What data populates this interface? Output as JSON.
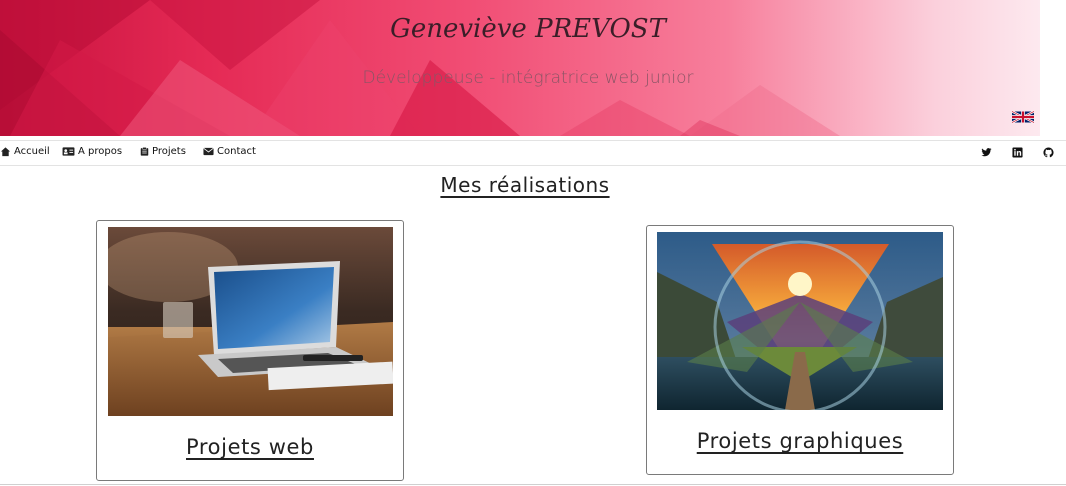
{
  "header": {
    "title": "Geneviève PREVOST",
    "subtitle": "Développeuse - intégratrice web junior",
    "language_icon": "uk-flag-icon"
  },
  "nav": {
    "items": [
      {
        "label": "Accueil",
        "icon": "home-icon"
      },
      {
        "label": "A propos",
        "icon": "id-card-icon"
      },
      {
        "label": "Projets",
        "icon": "clipboard-icon"
      },
      {
        "label": "Contact",
        "icon": "envelope-icon"
      }
    ],
    "social": [
      "twitter-icon",
      "linkedin-icon",
      "github-icon"
    ]
  },
  "main": {
    "section_title": "Mes réalisations",
    "cards": [
      {
        "label": "Projets web",
        "image": "laptop-photo"
      },
      {
        "label": "Projets graphiques",
        "image": "sunset-triangle-artwork"
      }
    ]
  },
  "colors": {
    "banner_primary": "#e52a55",
    "banner_light": "#fde9ef",
    "text_dark": "#222222"
  }
}
